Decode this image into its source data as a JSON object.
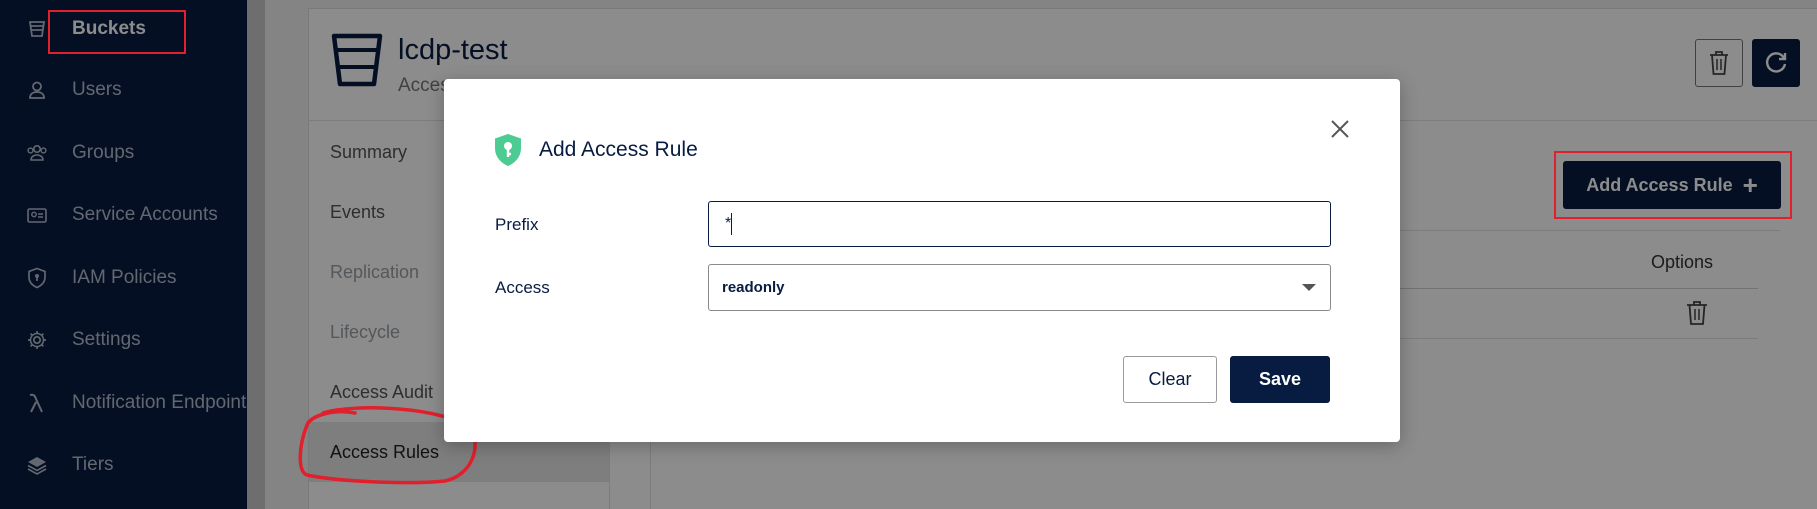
{
  "sidebar": {
    "items": [
      {
        "label": "Buckets",
        "icon": "bucket-icon"
      },
      {
        "label": "Users",
        "icon": "user-icon"
      },
      {
        "label": "Groups",
        "icon": "groups-icon"
      },
      {
        "label": "Service Accounts",
        "icon": "service-accounts-icon"
      },
      {
        "label": "IAM Policies",
        "icon": "shield-icon"
      },
      {
        "label": "Settings",
        "icon": "gear-icon"
      },
      {
        "label": "Notification Endpoints",
        "icon": "lambda-icon"
      },
      {
        "label": "Tiers",
        "icon": "layers-icon"
      }
    ],
    "active": "Buckets"
  },
  "bucket": {
    "name": "lcdp-test",
    "subtitle": "Access"
  },
  "tabs": [
    {
      "label": "Summary"
    },
    {
      "label": "Events"
    },
    {
      "label": "Replication"
    },
    {
      "label": "Lifecycle"
    },
    {
      "label": "Access Audit"
    },
    {
      "label": "Access Rules"
    }
  ],
  "selected_tab": "Access Rules",
  "add_rule_button": {
    "label": "Add Access Rule",
    "icon": "plus-icon"
  },
  "table": {
    "options_header": "Options"
  },
  "modal": {
    "title": "Add Access Rule",
    "prefix_label": "Prefix",
    "prefix_value": "*",
    "access_label": "Access",
    "access_value": "readonly",
    "clear_label": "Clear",
    "save_label": "Save"
  },
  "colors": {
    "sidebar_bg": "#081c42",
    "primary": "#081c42",
    "shield_green": "#4ccb92",
    "annotation_red": "#e0202c"
  }
}
